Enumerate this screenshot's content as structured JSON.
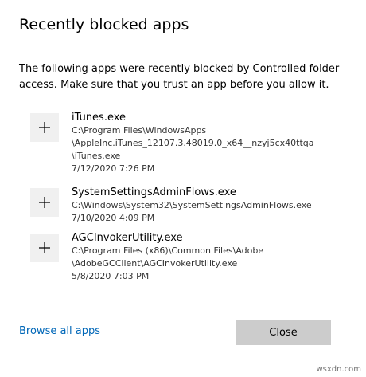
{
  "dialog": {
    "title": "Recently blocked apps",
    "description": "The following apps were recently blocked by Controlled folder access. Make sure that you trust an app before you allow it."
  },
  "apps": [
    {
      "name": "iTunes.exe",
      "path_lines": [
        "C:\\Program Files\\WindowsApps",
        "\\AppleInc.iTunes_12107.3.48019.0_x64__nzyj5cx40ttqa",
        "\\iTunes.exe"
      ],
      "date": "7/12/2020 7:26 PM",
      "action_icon": "plus-icon"
    },
    {
      "name": "SystemSettingsAdminFlows.exe",
      "path_lines": [
        "C:\\Windows\\System32\\SystemSettingsAdminFlows.exe"
      ],
      "date": "7/10/2020 4:09 PM",
      "action_icon": "plus-icon"
    },
    {
      "name": "AGCInvokerUtility.exe",
      "path_lines": [
        "C:\\Program Files (x86)\\Common Files\\Adobe",
        "\\AdobeGCClient\\AGCInvokerUtility.exe"
      ],
      "date": "5/8/2020 7:03 PM",
      "action_icon": "plus-icon"
    }
  ],
  "footer": {
    "browse_label": "Browse all apps",
    "close_label": "Close"
  },
  "watermark": "wsxdn.com",
  "colors": {
    "link": "#0067b8",
    "button_bg": "#cccccc",
    "add_button_bg": "#f0f0f0"
  }
}
